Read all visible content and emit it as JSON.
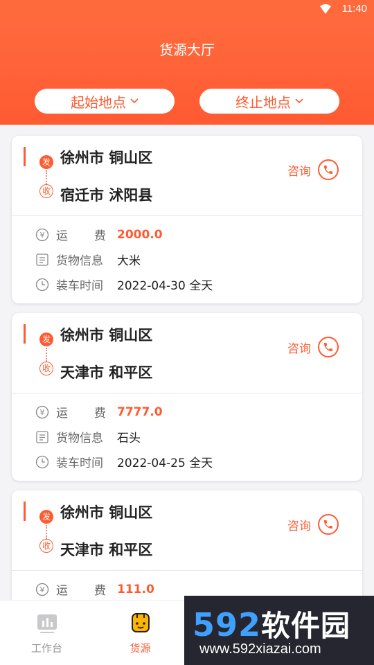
{
  "status_bar": {
    "time": "11:40"
  },
  "header": {
    "title": "货源大厅",
    "start_filter": "起始地点",
    "end_filter": "终止地点"
  },
  "labels": {
    "send": "发",
    "receive": "收",
    "consult": "咨询",
    "fee_chars": [
      "运",
      "费"
    ],
    "goods_info": "货物信息",
    "loading_time": "装车时间"
  },
  "cards": [
    {
      "from": "徐州市 铜山区",
      "to": "宿迁市 沭阳县",
      "fee": "2000.0",
      "goods": "大米",
      "time": "2022-04-30 全天"
    },
    {
      "from": "徐州市 铜山区",
      "to": "天津市 和平区",
      "fee": "7777.0",
      "goods": "石头",
      "time": "2022-04-25 全天"
    },
    {
      "from": "徐州市 铜山区",
      "to": "天津市 和平区",
      "fee": "111.0",
      "goods": "",
      "time": ""
    }
  ],
  "tabs": [
    {
      "label": "工作台",
      "icon": "chart-icon",
      "active": false
    },
    {
      "label": "货源",
      "icon": "goods-icon",
      "active": true
    }
  ],
  "watermark": {
    "brand_digits": "592",
    "brand_cn": "软件园",
    "url": "www.592xiazai.com"
  },
  "colors": {
    "accent": "#ff5a30",
    "header": "#ff6a3d"
  }
}
